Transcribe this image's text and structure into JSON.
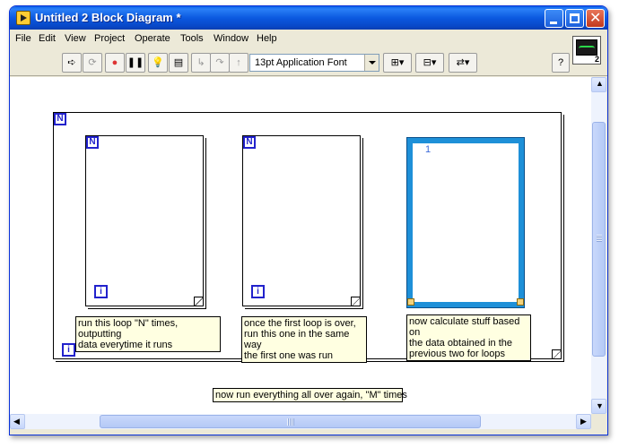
{
  "window": {
    "title": "Untitled 2 Block Diagram *",
    "title_color": "#0a5fe8"
  },
  "menu": [
    "File",
    "Edit",
    "View",
    "Project",
    "Operate",
    "Tools",
    "Window",
    "Help"
  ],
  "toolbar": {
    "font": "13pt Application Font",
    "icons": [
      "run-arrow-icon",
      "run-continuously-icon",
      "abort-icon",
      "pause-icon",
      "highlight-execution-icon",
      "retain-wire-values-icon",
      "step-into-icon",
      "step-over-icon",
      "step-out-icon",
      "align-objects-icon",
      "distribute-objects-icon",
      "reorder-icon",
      "help-icon"
    ],
    "connector_count": "2"
  },
  "diagram": {
    "outer_loop": {
      "n_label": "N",
      "i_label": "i"
    },
    "loop1": {
      "n_label": "N",
      "i_label": "i"
    },
    "loop2": {
      "n_label": "N",
      "i_label": "i"
    },
    "sequence": {
      "frame_label": "1"
    },
    "notes": {
      "note1": "run this loop \"N\" times, outputting\ndata everytime it runs",
      "note2": "once the first loop is over,\nrun this one in the same way\nthe first one was run",
      "note3": "now calculate stuff based on\nthe data obtained in the\nprevious two for loops",
      "note4": "now run everything all over again, \"M\" times"
    }
  },
  "colors": {
    "loop_border": "#2222cc",
    "sequence_border": "#1e90d8",
    "note_background": "#ffffe1"
  }
}
